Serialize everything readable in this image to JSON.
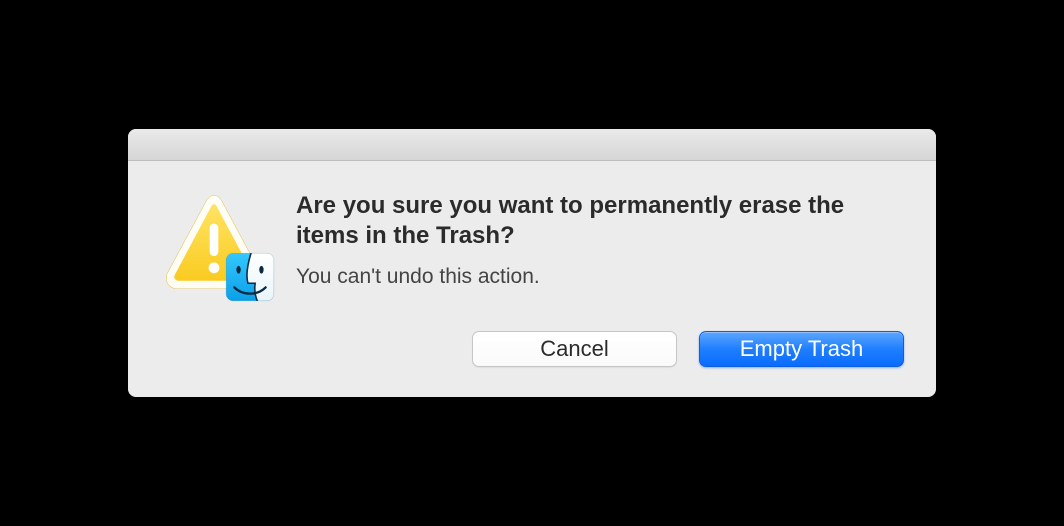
{
  "dialog": {
    "heading": "Are you sure you want to permanently erase the items in the Trash?",
    "message": "You can't undo this action.",
    "buttons": {
      "cancel": "Cancel",
      "confirm": "Empty Trash"
    }
  }
}
